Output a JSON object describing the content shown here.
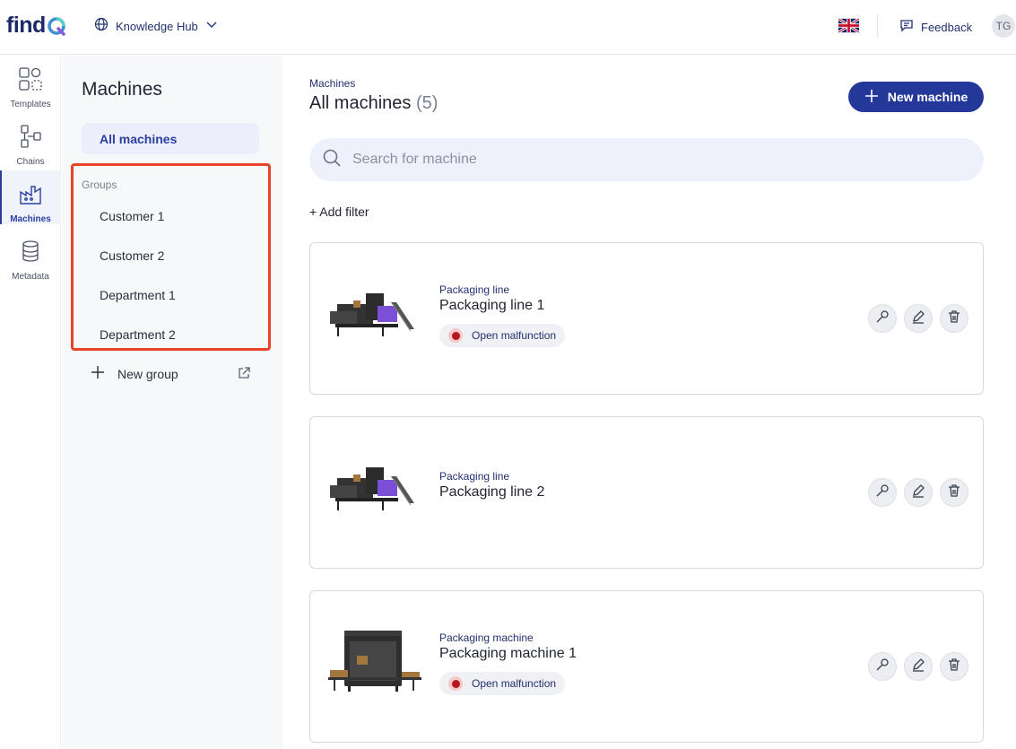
{
  "header": {
    "logo_text": "find",
    "workspace_label": "Knowledge Hub",
    "feedback_label": "Feedback",
    "avatar_initials": "TG"
  },
  "rail": {
    "items": [
      {
        "label": "Templates",
        "icon": "templates-icon"
      },
      {
        "label": "Chains",
        "icon": "chains-icon"
      },
      {
        "label": "Machines",
        "icon": "machines-icon",
        "active": true
      },
      {
        "label": "Metadata",
        "icon": "metadata-icon"
      }
    ]
  },
  "sidebar": {
    "title": "Machines",
    "all_machines": "All machines",
    "groups_label": "Groups",
    "groups": [
      "Customer 1",
      "Customer 2",
      "Department 1",
      "Department 2"
    ],
    "new_group": "New group"
  },
  "main": {
    "breadcrumb": "Machines",
    "title": "All machines",
    "count": "(5)",
    "new_machine_label": "New machine",
    "search_placeholder": "Search for machine",
    "add_filter": "+ Add filter",
    "machines": [
      {
        "category": "Packaging line",
        "name": "Packaging line 1",
        "status": "Open malfunction"
      },
      {
        "category": "Packaging line",
        "name": "Packaging line 2",
        "status": ""
      },
      {
        "category": "Packaging machine",
        "name": "Packaging machine 1",
        "status": "Open malfunction"
      }
    ]
  },
  "colors": {
    "brand": "#24389a",
    "highlight_border": "#e8432a",
    "malfunction": "#b3171f"
  }
}
